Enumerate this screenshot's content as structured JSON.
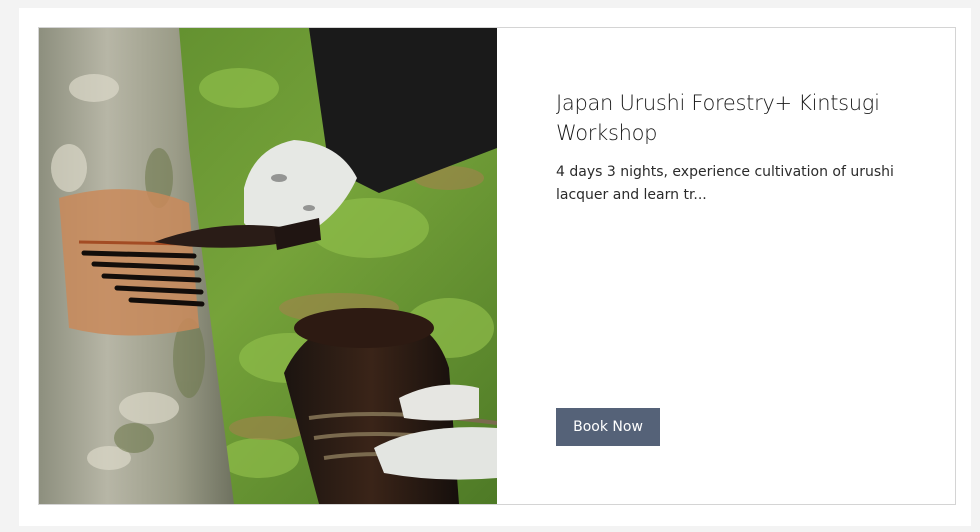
{
  "service_card": {
    "image_alt": "Urushi sap tapping on a tree trunk",
    "title": "Japan Urushi Forestry+ Kintsugi Workshop",
    "description": "4 days 3 nights, experience cultivation of urushi lacquer and learn tr...",
    "book_button_label": "Book Now"
  },
  "colors": {
    "button_bg": "#556278",
    "page_bg": "#f3f3f3",
    "card_border": "#d4d4d4"
  }
}
